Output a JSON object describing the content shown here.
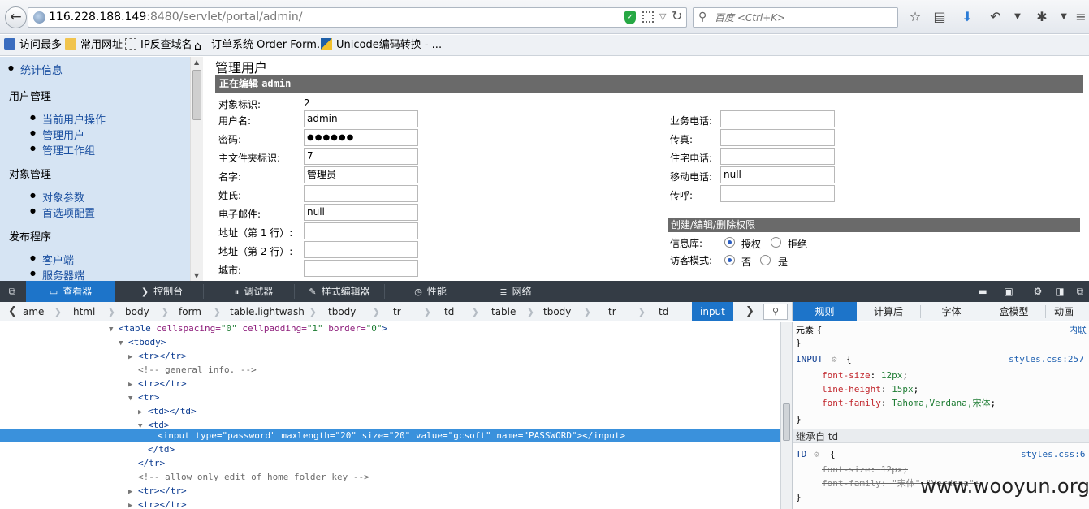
{
  "browser": {
    "url_host": "116.228.188.149",
    "url_rest": ":8480/servlet/portal/admin/",
    "search_placeholder": "百度 <Ctrl+K>",
    "bookmarks": [
      {
        "label": "访问最多"
      },
      {
        "label": "常用网址"
      },
      {
        "label": "IP反查域名"
      },
      {
        "label": "订单系统 Order Form..."
      },
      {
        "label": "Unicode编码转换 - ..."
      }
    ]
  },
  "nav": {
    "stats_label": "统计信息",
    "section_users": "用户管理",
    "item_current_ops": "当前用户操作",
    "item_manage_users": "管理用户",
    "item_manage_groups": "管理工作组",
    "section_objects": "对象管理",
    "item_object_params": "对象参数",
    "item_preferences": "首选项配置",
    "section_publish": "发布程序",
    "item_client": "客户端",
    "item_server": "服务器端"
  },
  "main": {
    "title": "管理用户",
    "editing_prefix": "正在编辑",
    "editing_user": "admin",
    "form_left": [
      {
        "label": "对象标识:",
        "value": "2",
        "is_text": true
      },
      {
        "label": "用户名:",
        "value": "admin"
      },
      {
        "label": "密码:",
        "value": "●●●●●●"
      },
      {
        "label": "主文件夹标识:",
        "value": "7"
      },
      {
        "label": "名字:",
        "value": "管理员"
      },
      {
        "label": "姓氏:",
        "value": ""
      },
      {
        "label": "电子邮件:",
        "value": "null"
      },
      {
        "label": "地址（第 1 行）:",
        "value": ""
      },
      {
        "label": "地址（第 2 行）:",
        "value": ""
      },
      {
        "label": "城市:",
        "value": ""
      }
    ],
    "form_right": [
      {
        "label": "业务电话:",
        "value": ""
      },
      {
        "label": "传真:",
        "value": ""
      },
      {
        "label": "住宅电话:",
        "value": ""
      },
      {
        "label": "移动电话:",
        "value": "null"
      },
      {
        "label": "传呼:",
        "value": ""
      }
    ],
    "perm_header": "创建/编辑/删除权限",
    "perm_info_label": "信息库:",
    "perm_grant": "授权",
    "perm_deny": "拒绝",
    "guest_label": "访客模式:",
    "guest_no": "否",
    "guest_yes": "是"
  },
  "devtools": {
    "tabs": [
      "查看器",
      "控制台",
      "调试器",
      "样式编辑器",
      "性能",
      "网络"
    ],
    "breadcrumbs": [
      "ame",
      "html",
      "body",
      "form",
      "table.lightwash",
      "tbody",
      "tr",
      "td",
      "table",
      "tbody",
      "tr",
      "td",
      "input"
    ],
    "side_tabs": [
      "规则",
      "计算后",
      "字体",
      "盒模型",
      "动画"
    ],
    "markup": {
      "l1_tag": "<table",
      "l1_a1": " cellspacing=",
      "l1_v1": "\"0\"",
      "l1_a2": " cellpadding=",
      "l1_v2": "\"1\"",
      "l1_a3": " border=",
      "l1_v3": "\"0\"",
      "l1_end": ">",
      "l2": "<tbody>",
      "l3": "<tr></tr>",
      "l4": "<!-- general info. -->",
      "l5": "<tr></tr>",
      "l6": "<tr>",
      "l7": "<td></td>",
      "l8": "<td>",
      "sel_line": "<input type=\"password\" maxlength=\"20\" size=\"20\" value=\"gcsoft\" name=\"PASSWORD\"></input>",
      "l10": "</td>",
      "l11": "</tr>",
      "l12": "<!-- allow only edit of home folder key -->",
      "l13": "<tr></tr>",
      "l14": "<tr></tr>"
    },
    "rules": {
      "element_label": "元素 {",
      "inline_label": "内联",
      "close": "}",
      "input_selector": "INPUT",
      "input_src": "styles.css:257",
      "p1": "font-size",
      "v1": "12px",
      "p2": "line-height",
      "v2": "15px",
      "p3": "font-family",
      "v3": "Tahoma,Verdana,宋体",
      "inherit_label": "继承自 td",
      "td_selector": "TD",
      "td_src": "styles.css:6",
      "tp1": "font-size",
      "tv1": "12px",
      "tp2": "font-family",
      "tv2": "\"宋体\",\"Verdana\""
    }
  },
  "watermark": "www.wooyun.org"
}
